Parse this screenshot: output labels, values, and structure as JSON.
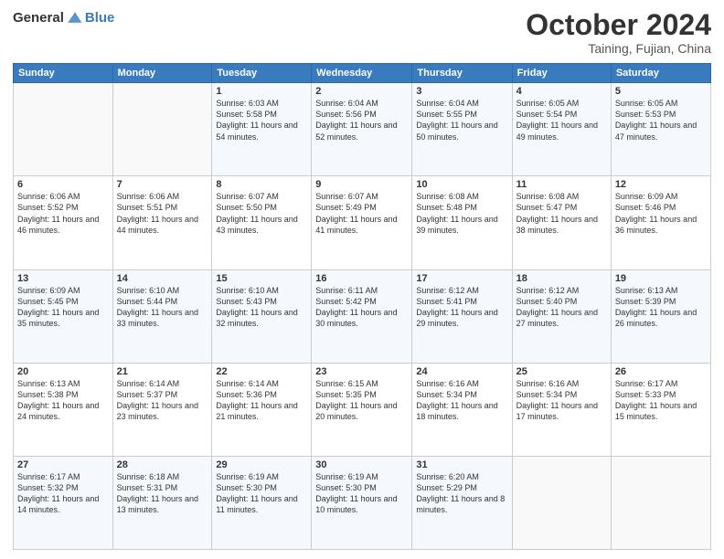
{
  "header": {
    "logo_general": "General",
    "logo_blue": "Blue",
    "month": "October 2024",
    "location": "Taining, Fujian, China"
  },
  "days_of_week": [
    "Sunday",
    "Monday",
    "Tuesday",
    "Wednesday",
    "Thursday",
    "Friday",
    "Saturday"
  ],
  "weeks": [
    [
      {
        "day": "",
        "sunrise": "",
        "sunset": "",
        "daylight": ""
      },
      {
        "day": "",
        "sunrise": "",
        "sunset": "",
        "daylight": ""
      },
      {
        "day": "1",
        "sunrise": "Sunrise: 6:03 AM",
        "sunset": "Sunset: 5:58 PM",
        "daylight": "Daylight: 11 hours and 54 minutes."
      },
      {
        "day": "2",
        "sunrise": "Sunrise: 6:04 AM",
        "sunset": "Sunset: 5:56 PM",
        "daylight": "Daylight: 11 hours and 52 minutes."
      },
      {
        "day": "3",
        "sunrise": "Sunrise: 6:04 AM",
        "sunset": "Sunset: 5:55 PM",
        "daylight": "Daylight: 11 hours and 50 minutes."
      },
      {
        "day": "4",
        "sunrise": "Sunrise: 6:05 AM",
        "sunset": "Sunset: 5:54 PM",
        "daylight": "Daylight: 11 hours and 49 minutes."
      },
      {
        "day": "5",
        "sunrise": "Sunrise: 6:05 AM",
        "sunset": "Sunset: 5:53 PM",
        "daylight": "Daylight: 11 hours and 47 minutes."
      }
    ],
    [
      {
        "day": "6",
        "sunrise": "Sunrise: 6:06 AM",
        "sunset": "Sunset: 5:52 PM",
        "daylight": "Daylight: 11 hours and 46 minutes."
      },
      {
        "day": "7",
        "sunrise": "Sunrise: 6:06 AM",
        "sunset": "Sunset: 5:51 PM",
        "daylight": "Daylight: 11 hours and 44 minutes."
      },
      {
        "day": "8",
        "sunrise": "Sunrise: 6:07 AM",
        "sunset": "Sunset: 5:50 PM",
        "daylight": "Daylight: 11 hours and 43 minutes."
      },
      {
        "day": "9",
        "sunrise": "Sunrise: 6:07 AM",
        "sunset": "Sunset: 5:49 PM",
        "daylight": "Daylight: 11 hours and 41 minutes."
      },
      {
        "day": "10",
        "sunrise": "Sunrise: 6:08 AM",
        "sunset": "Sunset: 5:48 PM",
        "daylight": "Daylight: 11 hours and 39 minutes."
      },
      {
        "day": "11",
        "sunrise": "Sunrise: 6:08 AM",
        "sunset": "Sunset: 5:47 PM",
        "daylight": "Daylight: 11 hours and 38 minutes."
      },
      {
        "day": "12",
        "sunrise": "Sunrise: 6:09 AM",
        "sunset": "Sunset: 5:46 PM",
        "daylight": "Daylight: 11 hours and 36 minutes."
      }
    ],
    [
      {
        "day": "13",
        "sunrise": "Sunrise: 6:09 AM",
        "sunset": "Sunset: 5:45 PM",
        "daylight": "Daylight: 11 hours and 35 minutes."
      },
      {
        "day": "14",
        "sunrise": "Sunrise: 6:10 AM",
        "sunset": "Sunset: 5:44 PM",
        "daylight": "Daylight: 11 hours and 33 minutes."
      },
      {
        "day": "15",
        "sunrise": "Sunrise: 6:10 AM",
        "sunset": "Sunset: 5:43 PM",
        "daylight": "Daylight: 11 hours and 32 minutes."
      },
      {
        "day": "16",
        "sunrise": "Sunrise: 6:11 AM",
        "sunset": "Sunset: 5:42 PM",
        "daylight": "Daylight: 11 hours and 30 minutes."
      },
      {
        "day": "17",
        "sunrise": "Sunrise: 6:12 AM",
        "sunset": "Sunset: 5:41 PM",
        "daylight": "Daylight: 11 hours and 29 minutes."
      },
      {
        "day": "18",
        "sunrise": "Sunrise: 6:12 AM",
        "sunset": "Sunset: 5:40 PM",
        "daylight": "Daylight: 11 hours and 27 minutes."
      },
      {
        "day": "19",
        "sunrise": "Sunrise: 6:13 AM",
        "sunset": "Sunset: 5:39 PM",
        "daylight": "Daylight: 11 hours and 26 minutes."
      }
    ],
    [
      {
        "day": "20",
        "sunrise": "Sunrise: 6:13 AM",
        "sunset": "Sunset: 5:38 PM",
        "daylight": "Daylight: 11 hours and 24 minutes."
      },
      {
        "day": "21",
        "sunrise": "Sunrise: 6:14 AM",
        "sunset": "Sunset: 5:37 PM",
        "daylight": "Daylight: 11 hours and 23 minutes."
      },
      {
        "day": "22",
        "sunrise": "Sunrise: 6:14 AM",
        "sunset": "Sunset: 5:36 PM",
        "daylight": "Daylight: 11 hours and 21 minutes."
      },
      {
        "day": "23",
        "sunrise": "Sunrise: 6:15 AM",
        "sunset": "Sunset: 5:35 PM",
        "daylight": "Daylight: 11 hours and 20 minutes."
      },
      {
        "day": "24",
        "sunrise": "Sunrise: 6:16 AM",
        "sunset": "Sunset: 5:34 PM",
        "daylight": "Daylight: 11 hours and 18 minutes."
      },
      {
        "day": "25",
        "sunrise": "Sunrise: 6:16 AM",
        "sunset": "Sunset: 5:34 PM",
        "daylight": "Daylight: 11 hours and 17 minutes."
      },
      {
        "day": "26",
        "sunrise": "Sunrise: 6:17 AM",
        "sunset": "Sunset: 5:33 PM",
        "daylight": "Daylight: 11 hours and 15 minutes."
      }
    ],
    [
      {
        "day": "27",
        "sunrise": "Sunrise: 6:17 AM",
        "sunset": "Sunset: 5:32 PM",
        "daylight": "Daylight: 11 hours and 14 minutes."
      },
      {
        "day": "28",
        "sunrise": "Sunrise: 6:18 AM",
        "sunset": "Sunset: 5:31 PM",
        "daylight": "Daylight: 11 hours and 13 minutes."
      },
      {
        "day": "29",
        "sunrise": "Sunrise: 6:19 AM",
        "sunset": "Sunset: 5:30 PM",
        "daylight": "Daylight: 11 hours and 11 minutes."
      },
      {
        "day": "30",
        "sunrise": "Sunrise: 6:19 AM",
        "sunset": "Sunset: 5:30 PM",
        "daylight": "Daylight: 11 hours and 10 minutes."
      },
      {
        "day": "31",
        "sunrise": "Sunrise: 6:20 AM",
        "sunset": "Sunset: 5:29 PM",
        "daylight": "Daylight: 11 hours and 8 minutes."
      },
      {
        "day": "",
        "sunrise": "",
        "sunset": "",
        "daylight": ""
      },
      {
        "day": "",
        "sunrise": "",
        "sunset": "",
        "daylight": ""
      }
    ]
  ]
}
